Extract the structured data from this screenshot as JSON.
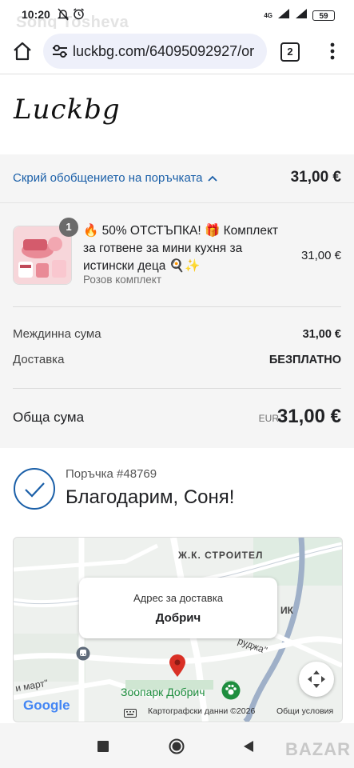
{
  "status_bar": {
    "time": "10:20",
    "ghost_text": "Sonq Tosheva",
    "network": "4G",
    "battery": "59"
  },
  "browser": {
    "url": "luckbg.com/64095092927/or",
    "tab_count": "2"
  },
  "store": {
    "logo": "Luckbg"
  },
  "summary": {
    "toggle_label": "Скрий обобщението на поръчката",
    "total": "31,00 €"
  },
  "order_item": {
    "quantity": "1",
    "title": "🔥 50% ОТСТЪПКА! 🎁 Комплект за готвене за мини кухня за истински деца 🍳✨",
    "variant": "Розов комплект",
    "price": "31,00 €"
  },
  "costs": {
    "subtotal_label": "Междинна сума",
    "subtotal_value": "31,00 €",
    "shipping_label": "Доставка",
    "shipping_value": "БЕЗПЛАТНО",
    "total_label": "Обща сума",
    "currency": "EUR",
    "total_value": "31,00 €"
  },
  "confirmation": {
    "order_number": "Поръчка #48769",
    "thank_you": "Благодарим, Соня!"
  },
  "map": {
    "card_label": "Адрес за доставка",
    "card_city": "Добрич",
    "district_label": "Ж.К. СТРОИТЕЛ",
    "partial_label_right": "ИК",
    "street_label_1": "руджа\"",
    "street_label_2": "и март\"",
    "zoo_label": "Зоопарк Добрич",
    "google_logo": "Google",
    "map_data": "Картографски данни ©2026",
    "terms": "Общи условия"
  },
  "watermark": "BAZAR",
  "colors": {
    "link": "#1a5fa8",
    "check": "#1a5fa8",
    "pin": "#d93025",
    "zoo": "#1e8e3e"
  }
}
